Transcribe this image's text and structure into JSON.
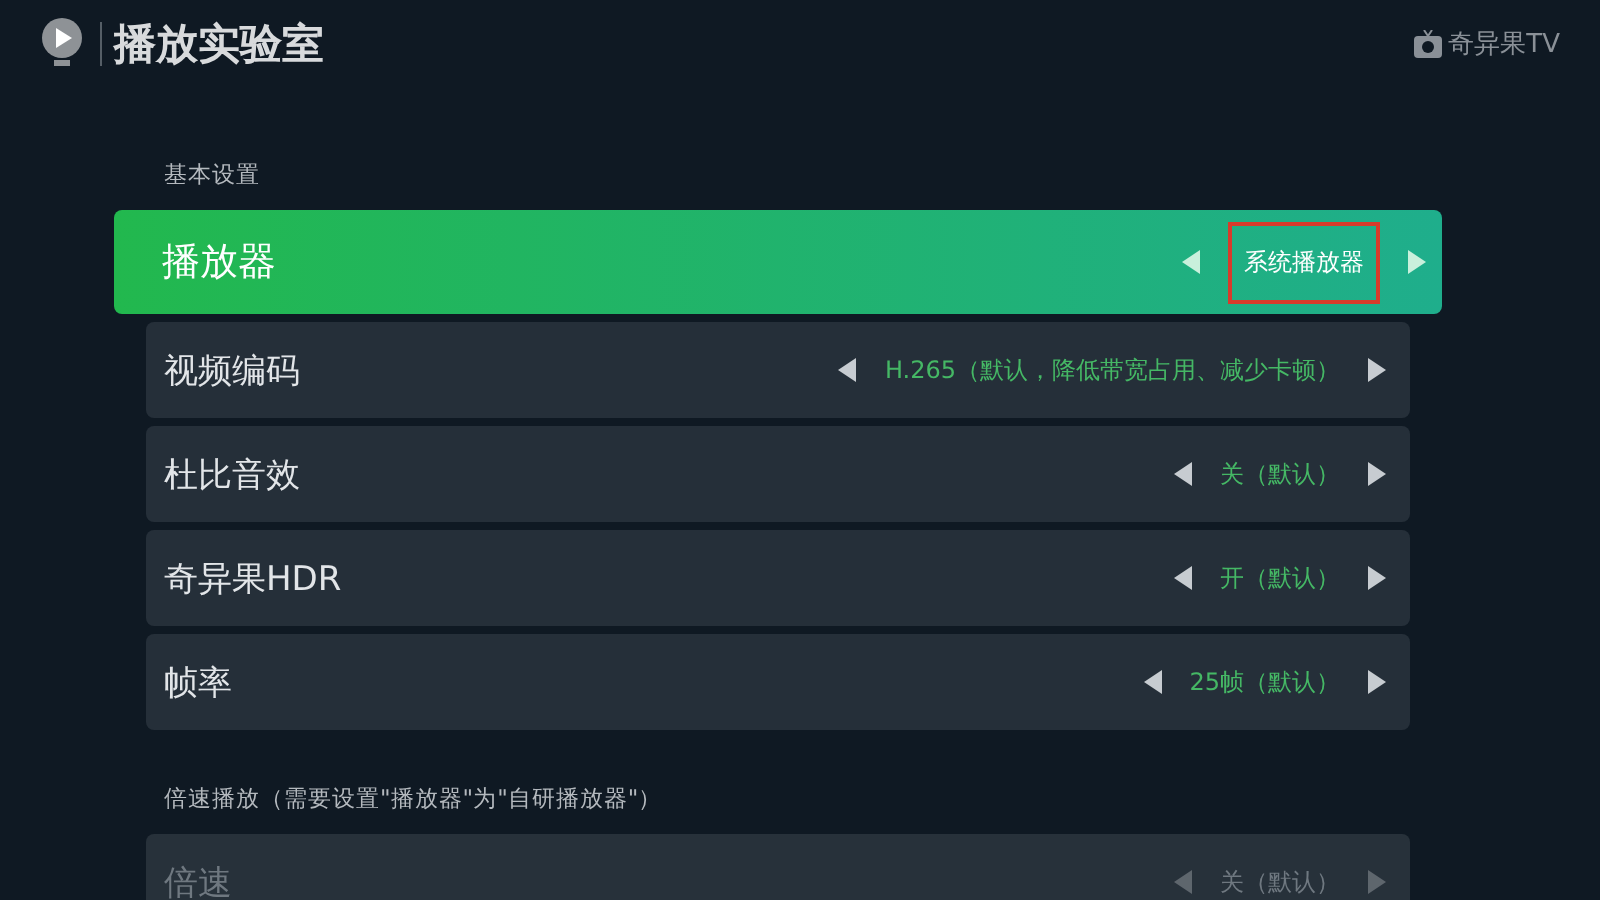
{
  "header": {
    "title": "播放实验室",
    "brand": "奇异果TV"
  },
  "sections": [
    {
      "title": "基本设置",
      "items": [
        {
          "label": "播放器",
          "value": "系统播放器",
          "focused": true,
          "disabled": false
        },
        {
          "label": "视频编码",
          "value": "H.265（默认，降低带宽占用、减少卡顿）",
          "focused": false,
          "disabled": false
        },
        {
          "label": "杜比音效",
          "value": "关（默认）",
          "focused": false,
          "disabled": false
        },
        {
          "label": "奇异果HDR",
          "value": "开（默认）",
          "focused": false,
          "disabled": false
        },
        {
          "label": "帧率",
          "value": "25帧（默认）",
          "focused": false,
          "disabled": false
        }
      ]
    },
    {
      "title": "倍速播放（需要设置\"播放器\"为\"自研播放器\"）",
      "items": [
        {
          "label": "倍速",
          "value": "关（默认）",
          "focused": false,
          "disabled": true
        }
      ]
    }
  ]
}
